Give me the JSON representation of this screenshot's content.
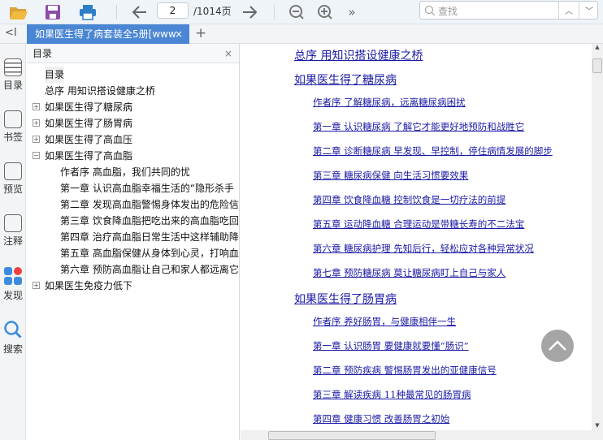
{
  "toolbar": {
    "page_current": "2",
    "page_total": "/1014页",
    "search_placeholder": "查找",
    "more": "»"
  },
  "tabs": {
    "collapse": "<I",
    "active_tab": "如果医生得了病套装全5册[www",
    "close": "×",
    "add": "+"
  },
  "rail": [
    {
      "label": "目录"
    },
    {
      "label": "书签"
    },
    {
      "label": "预览"
    },
    {
      "label": "注释"
    },
    {
      "label": "发现"
    },
    {
      "label": "搜索"
    }
  ],
  "outline": {
    "title": "目录",
    "close": "×",
    "items": [
      {
        "label": "目录",
        "level": 0,
        "toggle": ""
      },
      {
        "label": "总序 用知识搭设健康之桥",
        "level": 0,
        "toggle": ""
      },
      {
        "label": "如果医生得了糖尿病",
        "level": 0,
        "toggle": "+"
      },
      {
        "label": "如果医生得了肠胃病",
        "level": 0,
        "toggle": "+"
      },
      {
        "label": "如果医生得了高血压",
        "level": 0,
        "toggle": "+"
      },
      {
        "label": "如果医生得了高血脂",
        "level": 0,
        "toggle": "−"
      },
      {
        "label": "作者序 高血脂，我们共同的忧",
        "level": 1,
        "toggle": ""
      },
      {
        "label": "第一章 认识高血脂幸福生活的“隐形杀手",
        "level": 1,
        "toggle": ""
      },
      {
        "label": "第二章 发现高血脂警惕身体发出的危险信",
        "level": 1,
        "toggle": ""
      },
      {
        "label": "第三章 饮食降血脂把吃出来的高血脂吃回",
        "level": 1,
        "toggle": ""
      },
      {
        "label": "第四章 治疗高血脂日常生活中这样辅助降",
        "level": 1,
        "toggle": ""
      },
      {
        "label": "第五章 高血脂保健从身体到心灵，打响血",
        "level": 1,
        "toggle": ""
      },
      {
        "label": "第六章 预防高血脂让自己和家人都远离它",
        "level": 1,
        "toggle": ""
      },
      {
        "label": "如果医生免疫力低下",
        "level": 0,
        "toggle": "+"
      }
    ]
  },
  "content": {
    "links": [
      {
        "text": "总序 用知识搭设健康之桥",
        "type": "h1"
      },
      {
        "text": "如果医生得了糖尿病",
        "type": "h1"
      },
      {
        "text": "作者序 了解糖尿病，远离糖尿病困扰",
        "type": "h2"
      },
      {
        "text": "第一章 认识糖尿病 了解它才能更好地预防和战胜它",
        "type": "h2"
      },
      {
        "text": "第二章 诊断糖尿病 早发现、早控制，停住病情发展的脚步",
        "type": "h2"
      },
      {
        "text": "第三章 糖尿病保健 向生活习惯要效果",
        "type": "h2"
      },
      {
        "text": "第四章 饮食降血糖 控制饮食是一切疗法的前提",
        "type": "h2"
      },
      {
        "text": "第五章 运动降血糖 合理运动是带糖长寿的不二法宝",
        "type": "h2"
      },
      {
        "text": "第六章 糖尿病护理 先知后行，轻松应对各种异常状况",
        "type": "h2"
      },
      {
        "text": "第七章 预防糖尿病 莫让糖尿病盯上自己与家人",
        "type": "h2"
      },
      {
        "text": "如果医生得了肠胃病",
        "type": "h1"
      },
      {
        "text": "作者序 养好肠胃，与健康相伴一生",
        "type": "h2"
      },
      {
        "text": "第一章 认识肠胃 要健康就要懂“肠识”",
        "type": "h2"
      },
      {
        "text": "第二章 预防疾病 警惕肠胃发出的亚健康信号",
        "type": "h2"
      },
      {
        "text": "第三章 解读疾病 11种最常见的肠胃病",
        "type": "h2"
      },
      {
        "text": "第四章 健康习惯 改善肠胃之初始",
        "type": "h2"
      }
    ]
  },
  "colors": {
    "accent": "#4a86d3",
    "link": "#1a1aa6"
  }
}
